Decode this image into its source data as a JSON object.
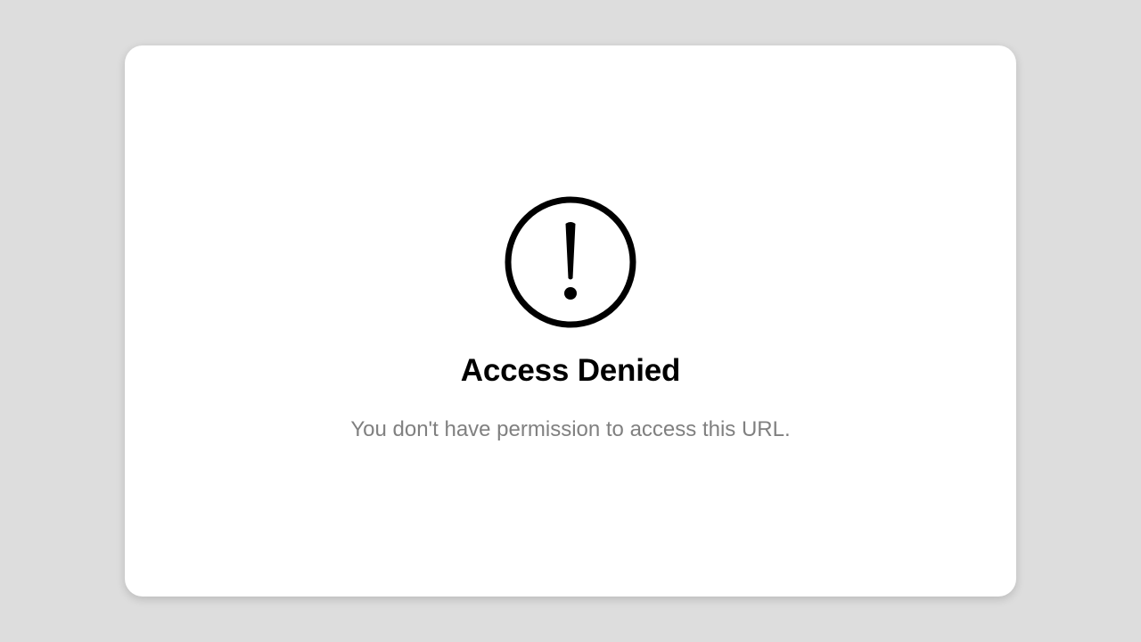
{
  "page": {
    "background_color": "#dddddd"
  },
  "card": {
    "background_color": "#ffffff",
    "icon": "exclamation-circle-icon",
    "title": "Access Denied",
    "message": "You don't have permission to access this URL."
  }
}
